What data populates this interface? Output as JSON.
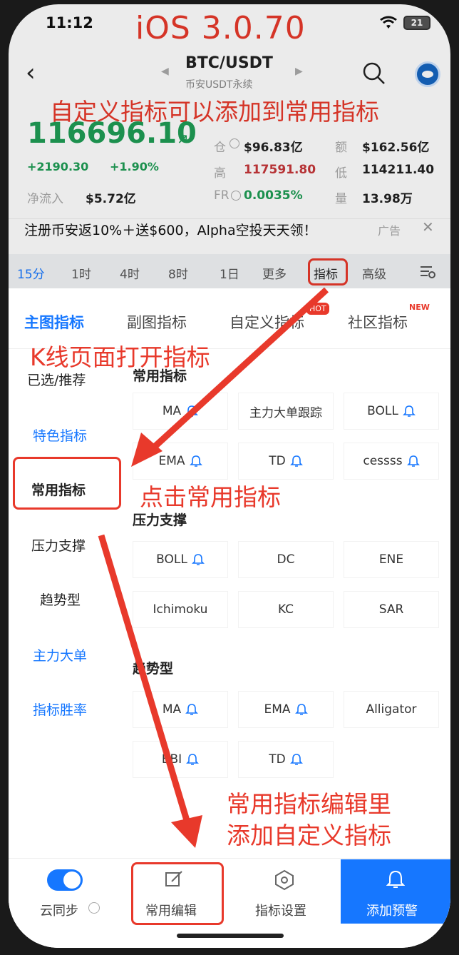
{
  "status": {
    "time": "11:12",
    "battery": "21",
    "version_annotation": "iOS 3.0.70"
  },
  "header": {
    "pair": "BTC/USDT",
    "subtitle": "币安USDT永续"
  },
  "annotations": {
    "top": "自定义指标可以添加到常用指标",
    "kline": "K线页面打开指标",
    "click": "点击常用指标",
    "edit_line1": "常用指标编辑里",
    "edit_line2": "添加自定义指标"
  },
  "price": {
    "last": "116696.10",
    "change": "+2190.30",
    "change_pct": "+1.90%",
    "net_inflow_label": "净流入",
    "net_inflow": "$5.72亿"
  },
  "stats": {
    "oi_label": "仓",
    "oi": "$96.83亿",
    "vol_label": "额",
    "vol": "$162.56亿",
    "high_label": "高",
    "high": "117591.80",
    "low_label": "低",
    "low": "114211.40",
    "fr_label": "FR",
    "fr": "0.0035%",
    "qty_label": "量",
    "qty": "13.98万"
  },
  "ad": {
    "text": "注册币安返10%＋送$600，Alpha空投天天领！",
    "tag": "广告",
    "close": "✕"
  },
  "timeframes": [
    "15分",
    "1时",
    "4时",
    "8时",
    "1日",
    "更多",
    "指标",
    "高级"
  ],
  "tabs": [
    "主图指标",
    "副图指标",
    "自定义指标",
    "社区指标"
  ],
  "tab_badges": {
    "hot": "HOT",
    "new": "NEW"
  },
  "sidebar": [
    "已选/推荐",
    "特色指标",
    "常用指标",
    "压力支撑",
    "趋势型",
    "主力大单",
    "指标胜率"
  ],
  "sections": [
    {
      "title": "常用指标",
      "items": [
        {
          "label": "MA",
          "bell": true
        },
        {
          "label": "主力大单跟踪",
          "bell": false
        },
        {
          "label": "BOLL",
          "bell": true
        },
        {
          "label": "EMA",
          "bell": true
        },
        {
          "label": "TD",
          "bell": true
        },
        {
          "label": "cessss",
          "bell": true
        }
      ]
    },
    {
      "title": "压力支撑",
      "items": [
        {
          "label": "BOLL",
          "bell": true
        },
        {
          "label": "DC",
          "bell": false
        },
        {
          "label": "ENE",
          "bell": false
        },
        {
          "label": "Ichimoku",
          "bell": false
        },
        {
          "label": "KC",
          "bell": false
        },
        {
          "label": "SAR",
          "bell": false
        }
      ]
    },
    {
      "title": "趋势型",
      "items": [
        {
          "label": "MA",
          "bell": true
        },
        {
          "label": "EMA",
          "bell": true
        },
        {
          "label": "Alligator",
          "bell": false
        },
        {
          "label": "BBI",
          "bell": true
        },
        {
          "label": "TD",
          "bell": true
        }
      ]
    }
  ],
  "bottom": {
    "sync": "云同步",
    "edit": "常用编辑",
    "settings": "指标设置",
    "alert": "添加预警"
  },
  "colors": {
    "accent": "#1677ff",
    "annotation": "#e8392b",
    "up": "#1f9d55",
    "down": "#c6373a"
  }
}
